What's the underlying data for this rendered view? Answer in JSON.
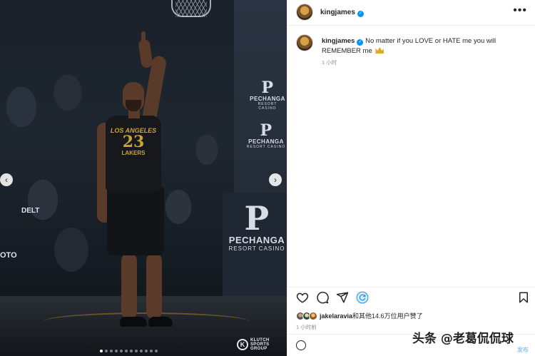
{
  "post": {
    "username": "kingjames",
    "caption": "No matter if you LOVE or HATE me you will REMEMBER me",
    "caption_time": "1 小时",
    "likes_user": "jakelaravia",
    "likes_rest": "和其他14.6万位用户赞了",
    "post_time": "1 小时前",
    "post_button": "发布"
  },
  "media": {
    "jersey_line1": "LOS ANGELES",
    "jersey_number": "23",
    "jersey_line3": "LAKERS",
    "sponsor_name": "PECHANGA",
    "sponsor_sub": "RESORT CASINO",
    "sponsor_logo": "P",
    "court_text_left": "DELT",
    "court_text_left2": "OTO",
    "klutch_icon": "K",
    "klutch_text": "KLUTCH SPORTS GROUP",
    "carousel_count": 12,
    "carousel_active": 1
  },
  "watermark": "头条 @老葛侃侃球",
  "icons": {
    "like": "heart-icon",
    "comment": "comment-icon",
    "share": "send-icon",
    "reshare": "refresh-icon",
    "save": "bookmark-icon",
    "more": "more-icon",
    "prev": "chevron-left-icon",
    "next": "chevron-right-icon",
    "verified": "verified-icon",
    "emoji": "emoji-icon"
  },
  "colors": {
    "verified": "#0095f6",
    "muted_text": "#8e8e8e",
    "jersey_gold": "#c9a43c"
  }
}
